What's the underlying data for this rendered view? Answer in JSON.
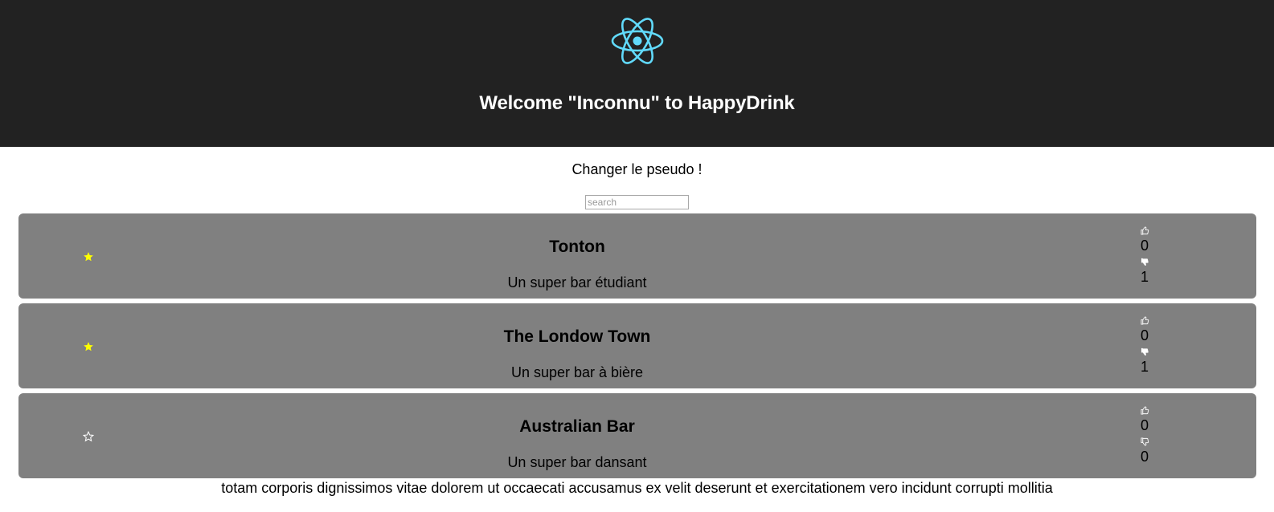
{
  "header": {
    "logo_icon": "react-atom-logo",
    "welcome_text": "Welcome \"Inconnu\" to HappyDrink",
    "background_color": "#222222",
    "logo_color": "#61dafb"
  },
  "change_pseudo_label": "Changer le pseudo !",
  "search": {
    "placeholder": "search",
    "value": ""
  },
  "bars": [
    {
      "name": "Tonton",
      "description": "Un super bar étudiant",
      "favorite": true,
      "likes": "0",
      "dislikes": "1"
    },
    {
      "name": "The Londow Town",
      "description": "Un super bar à bière",
      "favorite": true,
      "likes": "0",
      "dislikes": "1"
    },
    {
      "name": "Australian Bar",
      "description": "Un super bar dansant",
      "favorite": false,
      "likes": "0",
      "dislikes": "0"
    }
  ],
  "footer_text": "totam corporis dignissimos vitae dolorem ut occaecati accusamus ex velit deserunt et exercitationem vero incidunt corrupti mollitia",
  "colors": {
    "card_background": "#808080",
    "star_favorite": "#ffff00",
    "star_empty": "#ffffff"
  }
}
